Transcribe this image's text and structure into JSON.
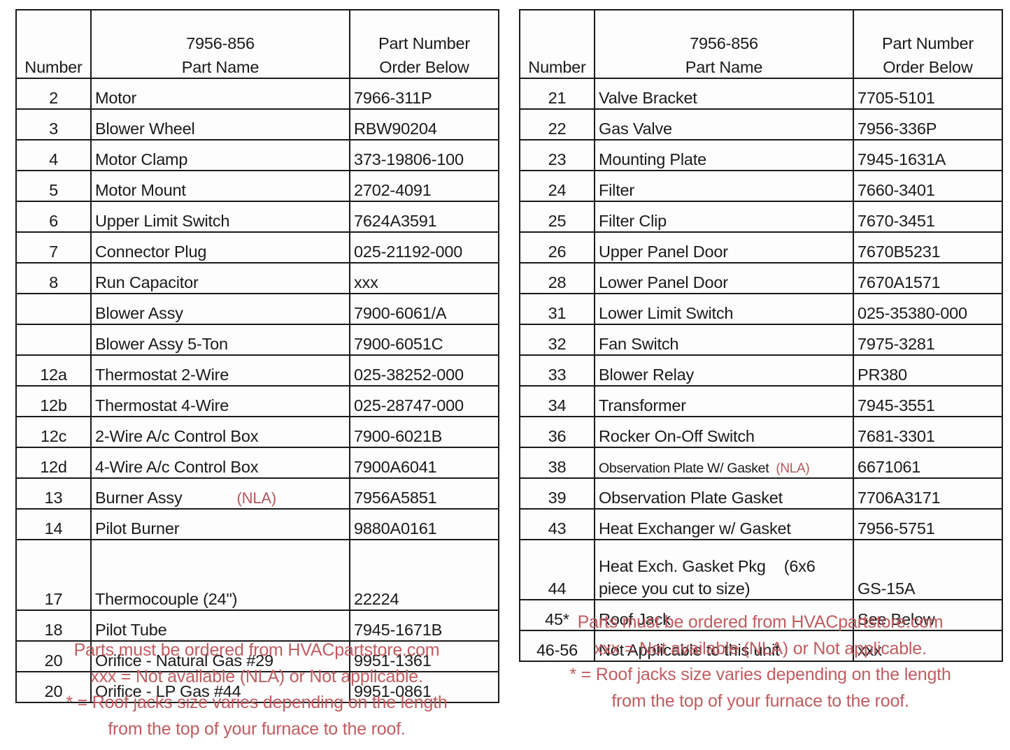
{
  "left_table": {
    "header": {
      "number": "Number",
      "part_name_line1": "7956-856",
      "part_name_line2": "Part Name",
      "part_number_line1": "Part Number",
      "part_number_line2": "Order Below"
    },
    "rows": [
      {
        "number": "2",
        "name": "Motor",
        "part": "7966-311P"
      },
      {
        "number": "3",
        "name": "Blower Wheel",
        "part": "RBW90204"
      },
      {
        "number": "4",
        "name": "Motor Clamp",
        "part": "373-19806-100"
      },
      {
        "number": "5",
        "name": "Motor Mount",
        "part": "2702-4091"
      },
      {
        "number": "6",
        "name": "Upper Limit Switch",
        "part": "7624A3591"
      },
      {
        "number": "7",
        "name": "Connector Plug",
        "part": "025-21192-000"
      },
      {
        "number": "8",
        "name": "Run Capacitor",
        "part": "xxx"
      },
      {
        "number": "",
        "name": "Blower Assy",
        "part": "7900-6061/A"
      },
      {
        "number": "",
        "name": "Blower Assy 5-Ton",
        "part": "7900-6051C"
      },
      {
        "number": "12a",
        "name": "Thermostat 2-Wire",
        "part": "025-38252-000"
      },
      {
        "number": "12b",
        "name": "Thermostat 4-Wire",
        "part": "025-28747-000"
      },
      {
        "number": "12c",
        "name": "2-Wire A/c Control Box",
        "part": "7900-6021B"
      },
      {
        "number": "12d",
        "name": "4-Wire A/c Control Box",
        "part": "7900A6041"
      },
      {
        "number": "13",
        "name": "Burner Assy",
        "nla": "(NLA)",
        "part": "7956A5851"
      },
      {
        "number": "14",
        "name": "Pilot Burner",
        "part": "9880A0161"
      },
      {
        "number": "17",
        "name": "Thermocouple (24\")",
        "part": "22224",
        "tall": true
      },
      {
        "number": "18",
        "name": "Pilot Tube",
        "part": "7945-1671B"
      },
      {
        "number": "20",
        "name": "Orifice - Natural Gas #29",
        "part": "9951-1361"
      },
      {
        "number": "20",
        "name": "Orifice - LP Gas #44",
        "part": "9951-0861"
      }
    ],
    "footnote": [
      "Parts must be ordered from HVACpartstore.com",
      "xxx = Not available (NLA) or Not applicable.",
      "* = Roof jacks size varies depending on the length",
      "from the top of your furnace to the roof."
    ]
  },
  "right_table": {
    "header": {
      "number": "Number",
      "part_name_line1": "7956-856",
      "part_name_line2": "Part Name",
      "part_number_line1": "Part Number",
      "part_number_line2": "Order Below"
    },
    "rows": [
      {
        "number": "21",
        "name": "Valve Bracket",
        "part": "7705-5101"
      },
      {
        "number": "22",
        "name": "Gas Valve",
        "part": "7956-336P"
      },
      {
        "number": "23",
        "name": "Mounting Plate",
        "part": "7945-1631A"
      },
      {
        "number": "24",
        "name": "Filter",
        "part": "7660-3401"
      },
      {
        "number": "25",
        "name": "Filter Clip",
        "part": "7670-3451"
      },
      {
        "number": "26",
        "name": "Upper Panel Door",
        "part": "7670B5231"
      },
      {
        "number": "28",
        "name": "Lower Panel Door",
        "part": "7670A1571"
      },
      {
        "number": "31",
        "name": "Lower Limit Switch",
        "part": "025-35380-000"
      },
      {
        "number": "32",
        "name": "Fan Switch",
        "part": "7975-3281"
      },
      {
        "number": "33",
        "name": "Blower Relay",
        "part": "PR380"
      },
      {
        "number": "34",
        "name": "Transformer",
        "part": "7945-3551"
      },
      {
        "number": "36",
        "name": "Rocker On-Off Switch",
        "part": "7681-3301"
      },
      {
        "number": "38",
        "name": "Observation Plate W/ Gasket",
        "nla": "(NLA)",
        "part": "6671061",
        "small": true
      },
      {
        "number": "39",
        "name": "Observation Plate Gasket",
        "part": "7706A3171"
      },
      {
        "number": "43",
        "name": "Heat Exchanger w/ Gasket",
        "part": "7956-5751"
      },
      {
        "number": "44",
        "name": "Heat Exch. Gasket Pkg",
        "name_extra": "(6x6",
        "name_line2": "piece you cut to size)",
        "part": "GS-15A",
        "tall2": true
      },
      {
        "number": "45*",
        "name": "Roof Jack",
        "part": "See Below"
      },
      {
        "number": "46-56",
        "name": "Not Applicable to this unit",
        "part": "xxx"
      }
    ],
    "footnote": [
      "Parts must be ordered from HVACpartstore.com",
      "xxx = Not available (NLA) or Not applicable.",
      "* = Roof jacks size varies depending on the length",
      "from the top of your furnace to the roof."
    ]
  },
  "colors": {
    "nla_red": "#b4585c",
    "footnote_red": "#c05c60",
    "border": "#1a1a1a"
  }
}
